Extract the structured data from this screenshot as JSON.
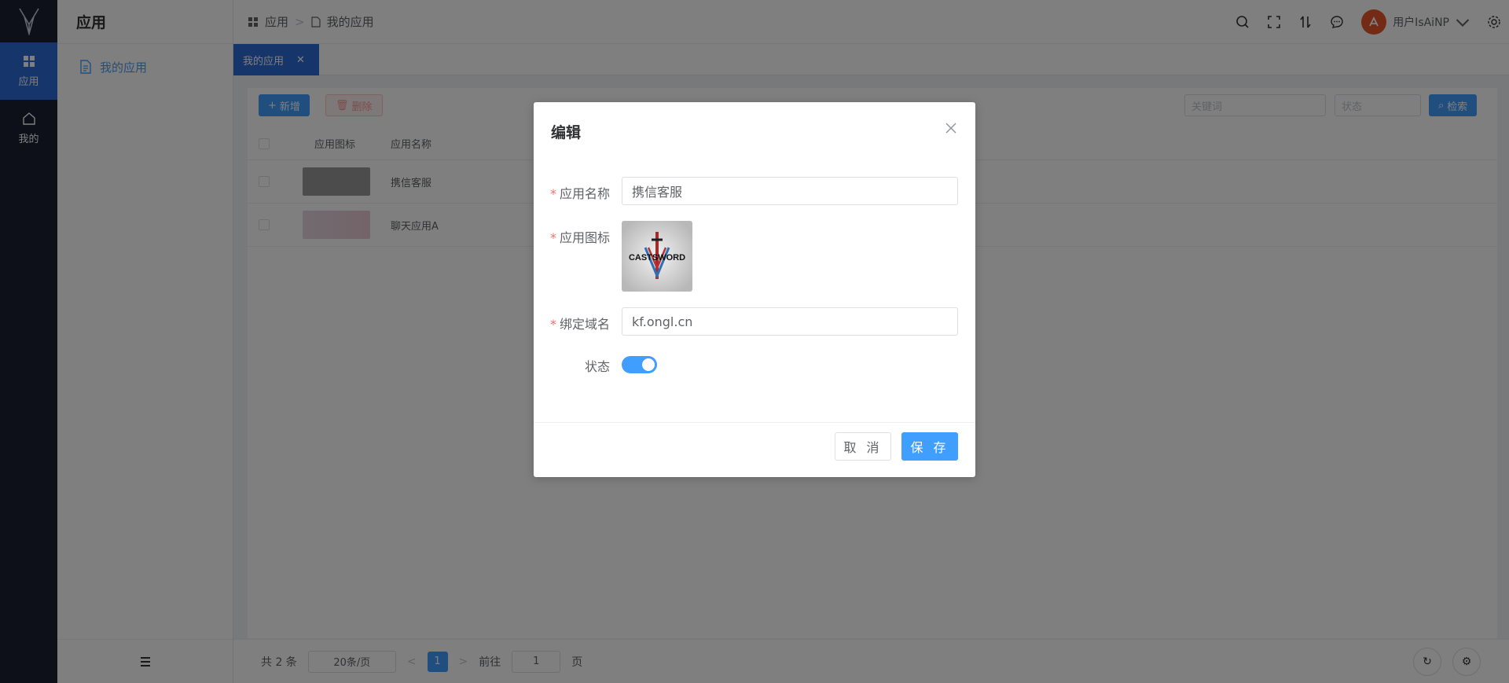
{
  "rail": {
    "items": [
      {
        "label": "应用",
        "icon": "grid-icon",
        "active": true
      },
      {
        "label": "我的",
        "icon": "home-icon",
        "active": false
      }
    ]
  },
  "submenu": {
    "title": "应用",
    "items": [
      {
        "label": "我的应用",
        "icon": "document-icon"
      }
    ]
  },
  "header": {
    "breadcrumb": [
      {
        "label": "应用",
        "icon": "grid-icon"
      },
      {
        "label": "我的应用",
        "icon": "document-icon"
      }
    ],
    "user_name": "用户IsAiNP"
  },
  "tabs": [
    {
      "label": "我的应用",
      "closable": true
    }
  ],
  "toolbar": {
    "add_label": "新增",
    "delete_label": "删除",
    "keyword_placeholder": "关键词",
    "status_placeholder": "状态",
    "search_label": "检索"
  },
  "table": {
    "columns": [
      "应用图标",
      "应用名称"
    ],
    "rows": [
      {
        "icon": "castsword-logo",
        "name": "携信客服"
      },
      {
        "icon": "flower-image",
        "name": "聊天应用A"
      }
    ]
  },
  "pagination": {
    "total_label": "共 2 条",
    "page_size": "20条/页",
    "current_page": "1",
    "goto_label": "前往",
    "goto_value": "1",
    "page_unit": "页"
  },
  "dialog": {
    "title": "编辑",
    "fields": {
      "app_name_label": "应用名称",
      "app_name_value": "携信客服",
      "app_icon_label": "应用图标",
      "app_icon_logo_text": "CASTSWORD",
      "domain_label": "绑定域名",
      "domain_value": "kf.ongl.cn",
      "status_label": "状态",
      "status_on": true
    },
    "cancel_label": "取 消",
    "save_label": "保 存"
  },
  "colors": {
    "rail_bg": "#1b2133",
    "primary": "#2b6bd6",
    "accent": "#409eff",
    "required": "#f56c6c"
  }
}
